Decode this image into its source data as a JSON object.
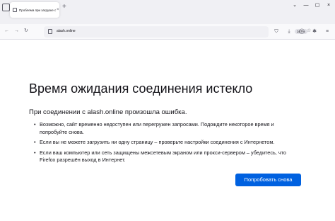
{
  "tab": {
    "title": "Проблема при загрузке стр",
    "close_glyph": "×",
    "new_tab_glyph": "+"
  },
  "window_controls": {
    "dropdown": "⌄",
    "minimize": "—",
    "maximize": "▢",
    "close": "×"
  },
  "nav": {
    "back": "←",
    "forward": "→",
    "reload": "↻"
  },
  "urlbar": {
    "url": "alash.online",
    "zoom": "167%",
    "bookmark": "☆"
  },
  "toolbar_icons": [
    "shield-icon",
    "download-icon",
    "account-icon",
    "extensions-icon",
    "menu-icon"
  ],
  "toolbar_glyphs": {
    "shield": "⛉",
    "download": "⤓",
    "account": "◯",
    "extensions": "✱",
    "menu": "≡"
  },
  "error": {
    "title": "Время ожидания соединения истекло",
    "intro": "При соединении с alash.online произошла ошибка.",
    "items": [
      "Возможно, сайт временно недоступен или перегружен запросами. Подождите некоторое время и попробуйте снова.",
      "Если вы не можете загрузить ни одну страницу – проверьте настройки соединения с Интернетом.",
      "Если ваш компьютер или сеть защищены межсетевым экраном или прокси-сервером – убедитесь, что Firefox разрешён выход в Интернет."
    ],
    "retry_label": "Попробовать снова"
  },
  "colors": {
    "accent": "#0061e0",
    "tabstrip": "#f0f0f4",
    "text": "#15141a"
  }
}
